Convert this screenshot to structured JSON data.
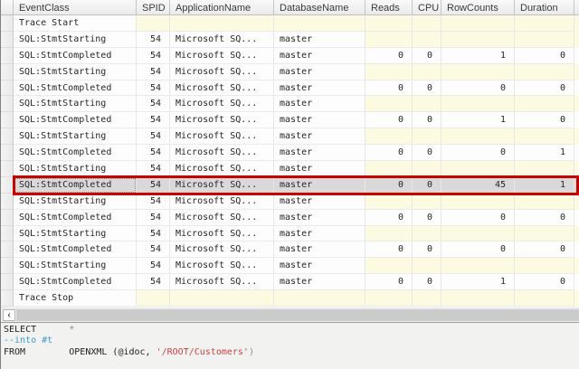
{
  "header": {
    "columns": [
      {
        "key": "event",
        "label": "EventClass"
      },
      {
        "key": "spid",
        "label": "SPID"
      },
      {
        "key": "app",
        "label": "ApplicationName"
      },
      {
        "key": "db",
        "label": "DatabaseName"
      },
      {
        "key": "reads",
        "label": "Reads"
      },
      {
        "key": "cpu",
        "label": "CPU"
      },
      {
        "key": "rowcounts",
        "label": "RowCounts"
      },
      {
        "key": "duration",
        "label": "Duration"
      }
    ]
  },
  "rows": [
    {
      "event": "Trace Start",
      "spid": "",
      "app": "",
      "db": "",
      "reads": "",
      "cpu": "",
      "rowcounts": "",
      "duration": "",
      "selected": false,
      "filler": "yellow"
    },
    {
      "event": "SQL:StmtStarting",
      "spid": "54",
      "app": "Microsoft SQ...",
      "db": "master",
      "reads": "",
      "cpu": "",
      "rowcounts": "",
      "duration": "",
      "selected": false,
      "filler": "yellow"
    },
    {
      "event": "SQL:StmtCompleted",
      "spid": "54",
      "app": "Microsoft SQ...",
      "db": "master",
      "reads": "0",
      "cpu": "0",
      "rowcounts": "1",
      "duration": "0",
      "selected": false,
      "filler": "white"
    },
    {
      "event": "SQL:StmtStarting",
      "spid": "54",
      "app": "Microsoft SQ...",
      "db": "master",
      "reads": "",
      "cpu": "",
      "rowcounts": "",
      "duration": "",
      "selected": false,
      "filler": "yellow"
    },
    {
      "event": "SQL:StmtCompleted",
      "spid": "54",
      "app": "Microsoft SQ...",
      "db": "master",
      "reads": "0",
      "cpu": "0",
      "rowcounts": "0",
      "duration": "0",
      "selected": false,
      "filler": "white"
    },
    {
      "event": "SQL:StmtStarting",
      "spid": "54",
      "app": "Microsoft SQ...",
      "db": "master",
      "reads": "",
      "cpu": "",
      "rowcounts": "",
      "duration": "",
      "selected": false,
      "filler": "yellow"
    },
    {
      "event": "SQL:StmtCompleted",
      "spid": "54",
      "app": "Microsoft SQ...",
      "db": "master",
      "reads": "0",
      "cpu": "0",
      "rowcounts": "1",
      "duration": "0",
      "selected": false,
      "filler": "white"
    },
    {
      "event": "SQL:StmtStarting",
      "spid": "54",
      "app": "Microsoft SQ...",
      "db": "master",
      "reads": "",
      "cpu": "",
      "rowcounts": "",
      "duration": "",
      "selected": false,
      "filler": "yellow"
    },
    {
      "event": "SQL:StmtCompleted",
      "spid": "54",
      "app": "Microsoft SQ...",
      "db": "master",
      "reads": "0",
      "cpu": "0",
      "rowcounts": "0",
      "duration": "1",
      "selected": false,
      "filler": "white"
    },
    {
      "event": "SQL:StmtStarting",
      "spid": "54",
      "app": "Microsoft SQ...",
      "db": "master",
      "reads": "",
      "cpu": "",
      "rowcounts": "",
      "duration": "",
      "selected": false,
      "filler": "yellow"
    },
    {
      "event": "SQL:StmtCompleted",
      "spid": "54",
      "app": "Microsoft SQ...",
      "db": "master",
      "reads": "0",
      "cpu": "0",
      "rowcounts": "45",
      "duration": "1",
      "selected": true,
      "filler": "gray"
    },
    {
      "event": "SQL:StmtStarting",
      "spid": "54",
      "app": "Microsoft SQ...",
      "db": "master",
      "reads": "",
      "cpu": "",
      "rowcounts": "",
      "duration": "",
      "selected": false,
      "filler": "yellow"
    },
    {
      "event": "SQL:StmtCompleted",
      "spid": "54",
      "app": "Microsoft SQ...",
      "db": "master",
      "reads": "0",
      "cpu": "0",
      "rowcounts": "0",
      "duration": "0",
      "selected": false,
      "filler": "white"
    },
    {
      "event": "SQL:StmtStarting",
      "spid": "54",
      "app": "Microsoft SQ...",
      "db": "master",
      "reads": "",
      "cpu": "",
      "rowcounts": "",
      "duration": "",
      "selected": false,
      "filler": "yellow"
    },
    {
      "event": "SQL:StmtCompleted",
      "spid": "54",
      "app": "Microsoft SQ...",
      "db": "master",
      "reads": "0",
      "cpu": "0",
      "rowcounts": "0",
      "duration": "0",
      "selected": false,
      "filler": "white"
    },
    {
      "event": "SQL:StmtStarting",
      "spid": "54",
      "app": "Microsoft SQ...",
      "db": "master",
      "reads": "",
      "cpu": "",
      "rowcounts": "",
      "duration": "",
      "selected": false,
      "filler": "yellow"
    },
    {
      "event": "SQL:StmtCompleted",
      "spid": "54",
      "app": "Microsoft SQ...",
      "db": "master",
      "reads": "0",
      "cpu": "0",
      "rowcounts": "1",
      "duration": "0",
      "selected": false,
      "filler": "white"
    },
    {
      "event": "Trace Stop",
      "spid": "",
      "app": "",
      "db": "",
      "reads": "",
      "cpu": "",
      "rowcounts": "",
      "duration": "",
      "selected": false,
      "filler": "yellow"
    }
  ],
  "scrollbar": {
    "left_arrow": "‹"
  },
  "sql_editor": {
    "lines": [
      {
        "segments": [
          {
            "text": "SELECT",
            "style": "plain"
          },
          {
            "text": "      ",
            "style": "plain"
          },
          {
            "text": "*",
            "style": "operator"
          }
        ]
      },
      {
        "segments": [
          {
            "text": "--into #t",
            "style": "comment"
          }
        ]
      },
      {
        "segments": [
          {
            "text": "FROM",
            "style": "plain"
          },
          {
            "text": "        ",
            "style": "plain"
          },
          {
            "text": "OPENXML (@idoc, ",
            "style": "plain"
          },
          {
            "text": "'/ROOT/Customers'",
            "style": "string"
          },
          {
            "text": ")",
            "style": "operator"
          }
        ]
      }
    ]
  },
  "colors": {
    "highlight_border": "#c80000",
    "selected_row_bg": "#d9d9d9",
    "empty_cell_bg": "#fcfae1",
    "comment_color": "#3e9bcd",
    "string_color": "#cc4444"
  }
}
